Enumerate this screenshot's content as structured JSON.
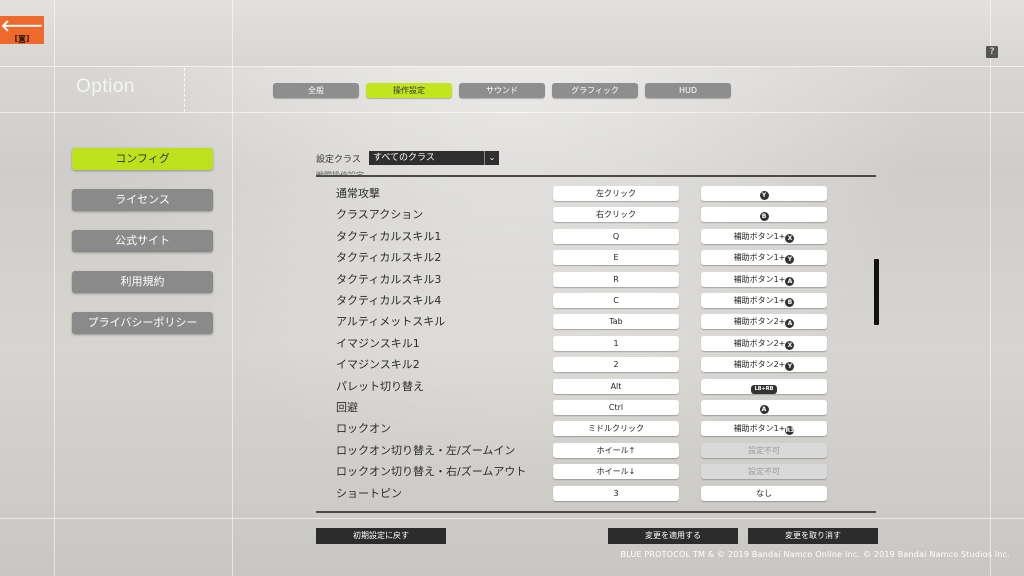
{
  "header": {
    "back_icon_glyph": "🡐",
    "back_sub": "[◙]",
    "help_glyph": "?",
    "title": "Option"
  },
  "tabs": [
    {
      "label": "全般",
      "active": false
    },
    {
      "label": "操作設定",
      "active": true
    },
    {
      "label": "サウンド",
      "active": false
    },
    {
      "label": "グラフィック",
      "active": false
    },
    {
      "label": "HUD",
      "active": false
    }
  ],
  "sidebar": {
    "items": [
      {
        "label": "コンフィグ",
        "active": true
      },
      {
        "label": "ライセンス",
        "active": false
      },
      {
        "label": "公式サイト",
        "active": false
      },
      {
        "label": "利用規約",
        "active": false
      },
      {
        "label": "プライバシーポリシー",
        "active": false
      }
    ]
  },
  "class_filter": {
    "label": "設定クラス",
    "value": "すべてのクラス",
    "caret": "⌄"
  },
  "section_header_cut": "戦闘操作設定",
  "bindings": [
    {
      "action": "通常攻撃",
      "key": "左クリック",
      "pad_text": "",
      "pad_glyph": "Y"
    },
    {
      "action": "クラスアクション",
      "key": "右クリック",
      "pad_text": "",
      "pad_glyph": "B"
    },
    {
      "action": "タクティカルスキル1",
      "key": "Q",
      "pad_text": "補助ボタン1+",
      "pad_glyph": "X"
    },
    {
      "action": "タクティカルスキル2",
      "key": "E",
      "pad_text": "補助ボタン1+",
      "pad_glyph": "Y"
    },
    {
      "action": "タクティカルスキル3",
      "key": "R",
      "pad_text": "補助ボタン1+",
      "pad_glyph": "A"
    },
    {
      "action": "タクティカルスキル4",
      "key": "C",
      "pad_text": "補助ボタン1+",
      "pad_glyph": "B"
    },
    {
      "action": "アルティメットスキル",
      "key": "Tab",
      "pad_text": "補助ボタン2+",
      "pad_glyph": "A"
    },
    {
      "action": "イマジンスキル1",
      "key": "1",
      "pad_text": "補助ボタン2+",
      "pad_glyph": "X"
    },
    {
      "action": "イマジンスキル2",
      "key": "2",
      "pad_text": "補助ボタン2+",
      "pad_glyph": "Y"
    },
    {
      "action": "パレット切り替え",
      "key": "Alt",
      "pad_text": "",
      "pad_glyph": "LB+RB"
    },
    {
      "action": "回避",
      "key": "Ctrl",
      "pad_text": "",
      "pad_glyph": "A"
    },
    {
      "action": "ロックオン",
      "key": "ミドルクリック",
      "pad_text": "補助ボタン1+",
      "pad_glyph": "R3"
    },
    {
      "action": "ロックオン切り替え・左/ズームイン",
      "key": "ホイール↑",
      "pad_text": "設定不可",
      "pad_glyph": ""
    },
    {
      "action": "ロックオン切り替え・右/ズームアウト",
      "key": "ホイール↓",
      "pad_text": "設定不可",
      "pad_glyph": ""
    },
    {
      "action": "ショートピン",
      "key": "3",
      "pad_text": "なし",
      "pad_glyph": ""
    }
  ],
  "bottom_buttons": {
    "reset": "初期設定に戻す",
    "apply": "変更を適用する",
    "cancel": "変更を取り消す"
  },
  "footer": "BLUE PROTOCOL TM & © 2019 Bandai Namco Online Inc.  © 2019 Bandai Namco Studios Inc."
}
